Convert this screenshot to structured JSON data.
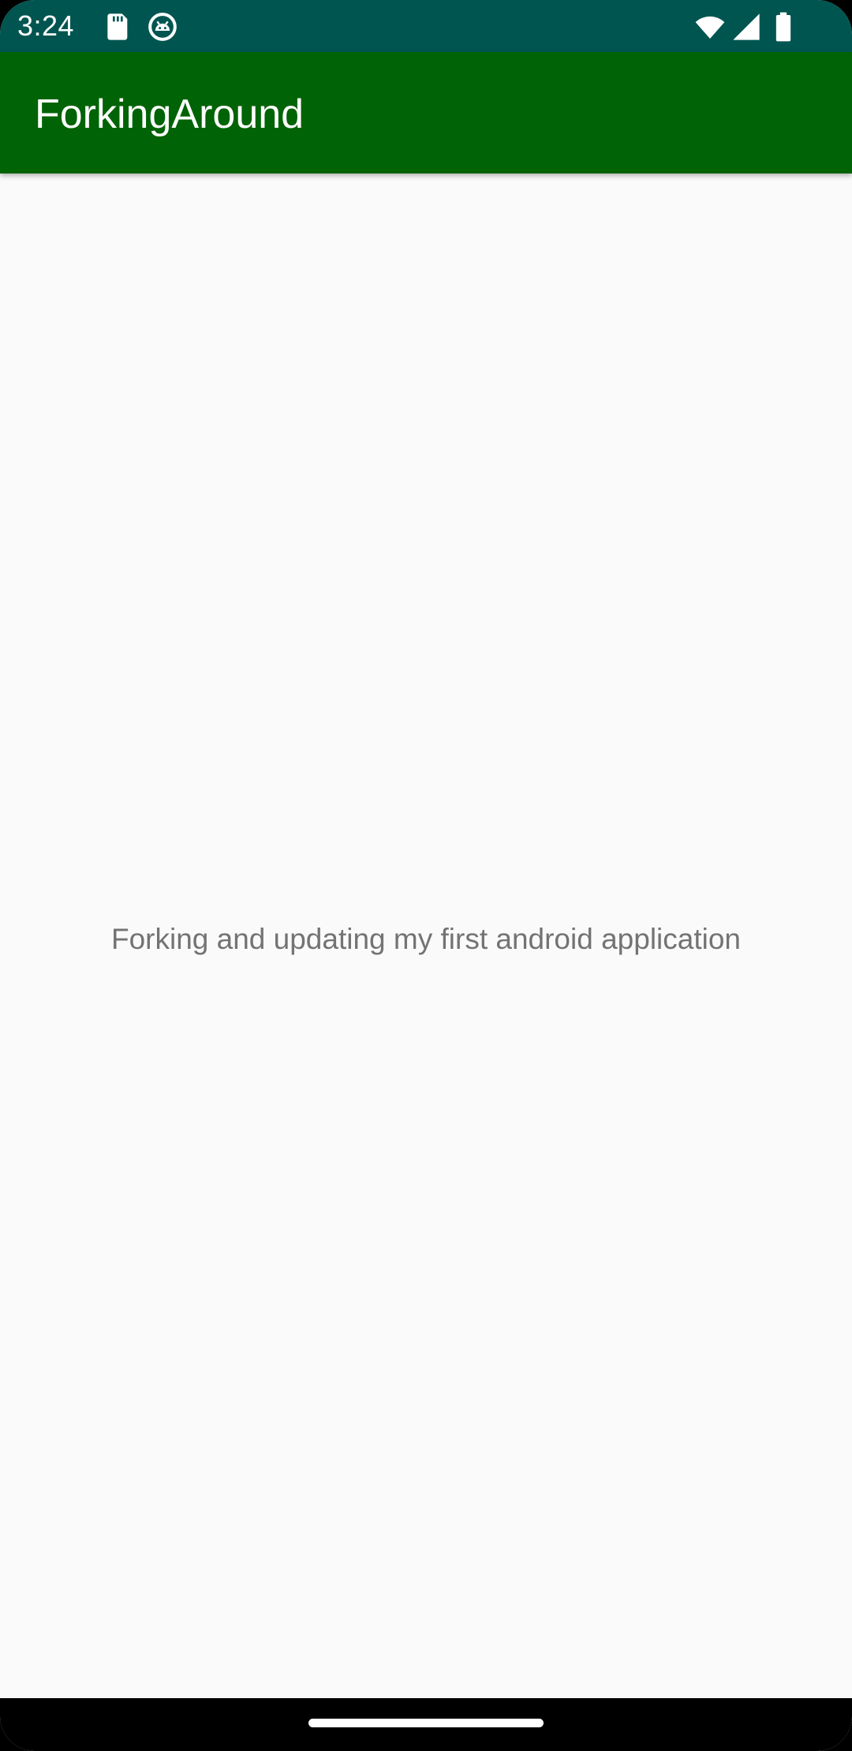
{
  "status_bar": {
    "time": "3:24",
    "icons": [
      "sd-card-icon",
      "android-debug-icon",
      "wifi-icon",
      "cellular-signal-icon",
      "battery-icon"
    ],
    "background_color": "#005550"
  },
  "app_bar": {
    "title": "ForkingAround",
    "background_color": "#006305"
  },
  "main": {
    "text": "Forking and updating my first android application",
    "text_color": "#737373",
    "background_color": "#fafafa"
  },
  "nav_bar": {
    "home_handle_icon": "home-gesture-handle",
    "background_color": "#000000"
  }
}
